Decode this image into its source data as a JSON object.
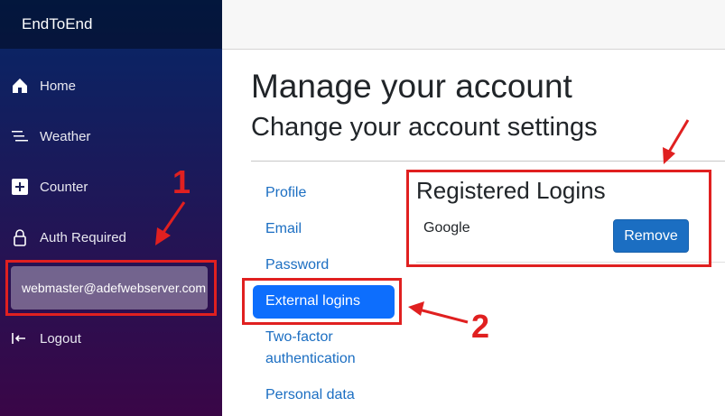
{
  "brand": "EndToEnd",
  "nav": [
    {
      "label": "Home",
      "icon": "home-icon"
    },
    {
      "label": "Weather",
      "icon": "list-icon"
    },
    {
      "label": "Counter",
      "icon": "plus-icon"
    },
    {
      "label": "Auth Required",
      "icon": "lock-icon"
    }
  ],
  "user": {
    "email": "webmaster@adefwebserver.com"
  },
  "logout": {
    "label": "Logout",
    "icon": "logout-icon"
  },
  "page": {
    "title": "Manage your account",
    "subtitle": "Change your account settings"
  },
  "account_nav": [
    {
      "label": "Profile"
    },
    {
      "label": "Email"
    },
    {
      "label": "Password"
    },
    {
      "label": "External logins",
      "active": true
    },
    {
      "label": "Two-factor authentication"
    },
    {
      "label": "Personal data"
    }
  ],
  "logins": {
    "title": "Registered Logins",
    "provider": "Google",
    "remove_label": "Remove"
  },
  "annotations": {
    "label_1": "1",
    "label_2": "2",
    "color": "#e02020"
  },
  "colors": {
    "sidebar_top": "#052767",
    "sidebar_bottom": "#3a0647",
    "link": "#1b6ec2",
    "active_link_bg": "#0d6efd"
  }
}
